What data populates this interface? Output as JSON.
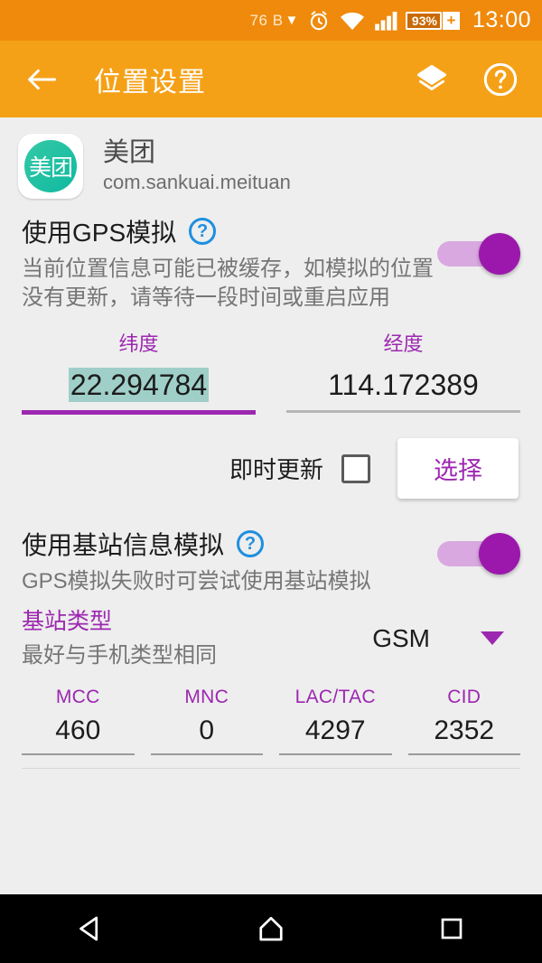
{
  "statusbar": {
    "network_speed": "76 B",
    "network_arrow": "▼",
    "alarm_icon": "alarm-clock-icon",
    "wifi_icon": "wifi-icon",
    "signal_icon": "cellular-signal-icon",
    "battery_level": "93%",
    "battery_charging": "+",
    "time": "13:00",
    "bg_color": "#ef8a0c"
  },
  "appbar": {
    "back_icon": "back-arrow-icon",
    "title": "位置设置",
    "layers_icon": "layers-icon",
    "help_icon": "help-circle-icon",
    "bg_color": "#f5a117"
  },
  "app": {
    "icon_text": "美团",
    "name": "美团",
    "package": "com.sankuai.meituan",
    "icon_color": "#18bfa0"
  },
  "gps_section": {
    "title": "使用GPS模拟",
    "help_icon": "help-circle-icon",
    "description": "当前位置信息可能已被缓存，如模拟的位置没有更新，请等待一段时间或重启应用",
    "toggle_state": "on",
    "toggle_color": "#9c18ad",
    "latitude": {
      "label": "纬度",
      "value": "22.294784",
      "selected": true,
      "selection_color": "#9fcfc8",
      "focused": true
    },
    "longitude": {
      "label": "经度",
      "value": "114.172389",
      "selected": false,
      "focused": false
    },
    "instant_update_label": "即时更新",
    "instant_update_checked": false,
    "select_button": "选择",
    "select_button_color": "#9c27b0"
  },
  "cell_section": {
    "title": "使用基站信息模拟",
    "help_icon": "help-circle-icon",
    "description": "GPS模拟失败时可尝试使用基站模拟",
    "toggle_state": "on",
    "type_label": "基站类型",
    "type_sublabel": "最好与手机类型相同",
    "type_value": "GSM",
    "dropdown_icon": "chevron-down-icon",
    "fields": [
      {
        "label": "MCC",
        "value": "460"
      },
      {
        "label": "MNC",
        "value": "0"
      },
      {
        "label": "LAC/TAC",
        "value": "4297"
      },
      {
        "label": "CID",
        "value": "2352"
      }
    ]
  },
  "navbar": {
    "back_icon": "nav-back-triangle-icon",
    "home_icon": "nav-home-icon",
    "recents_icon": "nav-recents-square-icon"
  }
}
